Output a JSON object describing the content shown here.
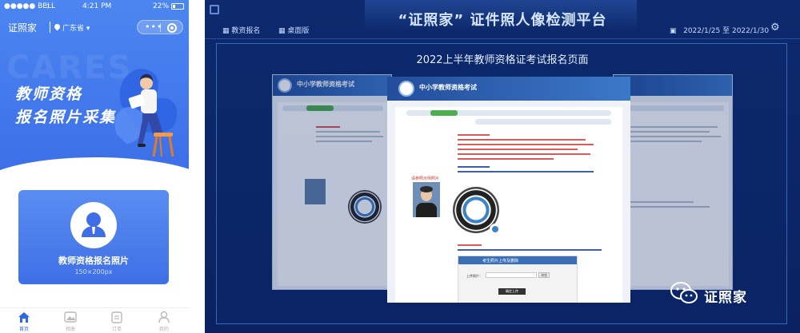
{
  "phone": {
    "status_bar": {
      "carrier": "●●●●● BELL",
      "time": "4:21 PM",
      "battery": "22%"
    },
    "app_name": "证照家",
    "region": "广东省",
    "capsule_dots": "•••",
    "watermark": "CARES",
    "hero_title_line1": "教师资格",
    "hero_title_line2": "报名照片采集",
    "card_label": "教师资格报名照片",
    "card_size": "150×200px",
    "tabs": [
      {
        "label": "首页",
        "icon": "home-icon",
        "active": true
      },
      {
        "label": "相册",
        "icon": "image-icon",
        "active": false
      },
      {
        "label": "订单",
        "icon": "order-icon",
        "active": false
      },
      {
        "label": "我的",
        "icon": "user-icon",
        "active": false
      }
    ],
    "colors": {
      "primary": "#3c6ee8",
      "active_tab": "#2f6ae6"
    }
  },
  "dashboard": {
    "title": "“证照家” 证件照人像检测平台",
    "menu": [
      "教资报名",
      "桌面版"
    ],
    "date_range": "2022/1/25 至 2022/1/30",
    "subtitle": "2022上半年教师资格证考试报名页面",
    "site_name": "中小学教师资格考试",
    "upload_title": "考生照片上传及删除",
    "upload_field": "上传照片：",
    "upload_browse": "浏览",
    "upload_confirm": "确定上传",
    "photo_prompt": "请参照示例照片",
    "brand_label": "证照家",
    "colors": {
      "background": "#0d2a6e",
      "frame": "#5aa0ff",
      "step_active": "#4cae4c"
    }
  }
}
